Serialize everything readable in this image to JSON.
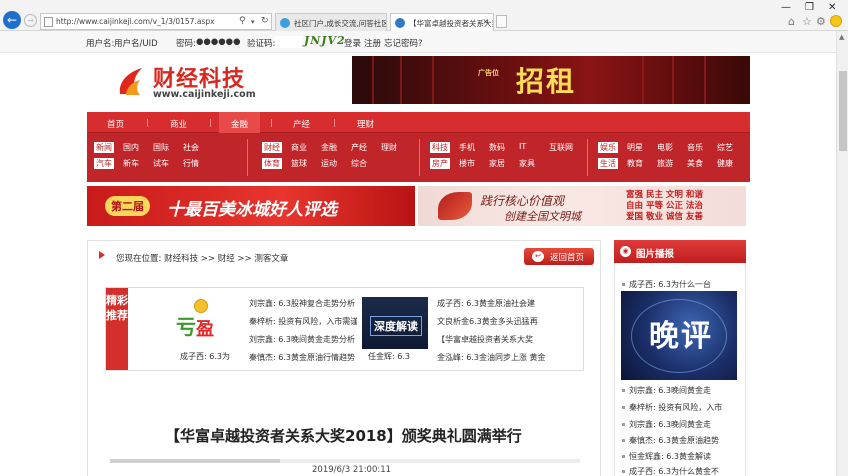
{
  "browser": {
    "url": "http://www.caijinkeji.com/v_1/3/0157.aspx",
    "tabs": [
      {
        "title": "社区门户,成长交流,问答社区"
      },
      {
        "title": "【华富卓越投资者关系大奖..."
      }
    ]
  },
  "login": {
    "username_label": "用户名:",
    "username_placeholder": "用户名/UID",
    "password_label": "密码:",
    "password_value": "●●●●●●",
    "captcha_label": "验证码:",
    "captcha_image_text": "JNJV2",
    "login_link": "登录",
    "register_link": "注册",
    "forgot_link": "忘记密码?"
  },
  "header": {
    "site_name": "财经科技",
    "site_url": "www.caijinkeji.com",
    "ad_small": "广告位",
    "ad_big": "招租"
  },
  "nav": {
    "top": [
      "首页",
      "商业",
      "金融",
      "产经",
      "理财"
    ],
    "active_index": 2,
    "groups": [
      {
        "tag1": "新闻",
        "row1": [
          "国内",
          "国际",
          "社会"
        ],
        "tag2": "汽车",
        "row2": [
          "新车",
          "试车",
          "行情"
        ]
      },
      {
        "tag1": "财经",
        "row1": [
          "商业",
          "金融",
          "产经",
          "理财"
        ],
        "tag2": "体育",
        "row2": [
          "篮球",
          "运动",
          "综合"
        ]
      },
      {
        "tag1": "科技",
        "row1": [
          "手机",
          "数码",
          "IT",
          "互联网"
        ],
        "tag2": "房产",
        "row2": [
          "楼市",
          "家居",
          "家具"
        ]
      },
      {
        "tag1": "娱乐",
        "row1": [
          "明星",
          "电影",
          "音乐",
          "综艺"
        ],
        "tag2": "生活",
        "row2": [
          "教育",
          "旅游",
          "美食",
          "健康"
        ]
      }
    ]
  },
  "banners": {
    "left_pill": "第二届",
    "left_text": "十最百美冰城好人评选",
    "right_line1": "践行核心价值观",
    "right_line2": "创建全国文明城",
    "right_grid": [
      "富强 民主 文明 和谐",
      "自由 平等 公正 法治",
      "爱国 敬业 诚信 友善"
    ]
  },
  "breadcrumb": {
    "prefix": "您现在位置:",
    "path": "财经科技 >> 财经 >> 测客文章"
  },
  "back_button": "返回首页",
  "feature": {
    "tag": "精彩推荐",
    "col1": [
      "刘宗鑫: 6.3股神复合走势分析",
      "秦梓析: 投资有风险，入市需谨",
      "刘宗鑫: 6.3晚间黄金走势分析",
      "秦慎杰: 6.3黄金原油行情趋势"
    ],
    "caption1": "成子西: 6.3为",
    "thumb2_text": "深度解读",
    "caption2": "任金辉: 6.3",
    "col2": [
      "成子西: 6.3黄金原油社会建",
      "文良析金6.3黄金多头迅猛再",
      "【华富卓越投资者关系大奖",
      "金泓峰: 6.3金油同步上涨 黄金"
    ]
  },
  "article": {
    "title": "【华富卓越投资者关系大奖2018】颁奖典礼圆满举行",
    "date": "2019/6/3 21:00:11"
  },
  "sidebar": {
    "title": "图片播报",
    "caption": "成子西: 6.3为什么一台",
    "photo_text": "晚评",
    "items": [
      "刘宗鑫: 6.3晚间黄金走",
      "秦梓析: 投资有风险，入市",
      "刘宗鑫: 6.3晚间黄金走",
      "秦慎杰: 6.3黄金原油趋势",
      "恒金辉鑫: 6.3黄金解读",
      "成子西: 6.3为什么黄金不"
    ]
  }
}
